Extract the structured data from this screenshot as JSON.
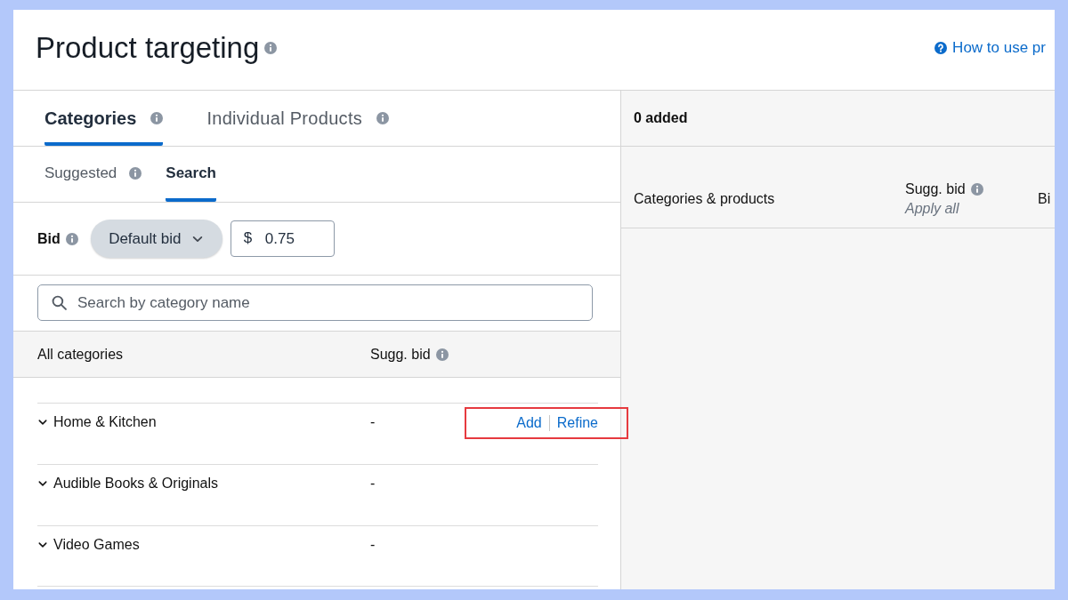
{
  "header": {
    "title": "Product targeting",
    "title_info": true,
    "help_link": "How to use pr"
  },
  "tabs": [
    {
      "label": "Categories",
      "info": true,
      "selected": true
    },
    {
      "label": "Individual Products",
      "info": true,
      "selected": false
    }
  ],
  "subtabs": [
    {
      "label": "Suggested",
      "info": true,
      "selected": false
    },
    {
      "label": "Search",
      "info": false,
      "selected": true
    }
  ],
  "bid": {
    "label": "Bid",
    "info": true,
    "mode": "Default bid",
    "currency": "$",
    "value": "0.75"
  },
  "search": {
    "placeholder": "Search by category name"
  },
  "categories_table": {
    "columns": [
      {
        "label": "All categories",
        "info": false
      },
      {
        "label": "Sugg. bid",
        "info": true
      }
    ],
    "rows": [
      {
        "name": "Home & Kitchen",
        "sugg_bid": "-",
        "actions": [
          "Add",
          "Refine"
        ],
        "highlighted": true
      },
      {
        "name": "Audible Books & Originals",
        "sugg_bid": "-",
        "highlighted": false
      },
      {
        "name": "Video Games",
        "sugg_bid": "-",
        "highlighted": false
      }
    ]
  },
  "added_panel": {
    "count_label": "0 added",
    "columns": [
      {
        "label": "Categories & products",
        "info": false
      },
      {
        "label": "Sugg. bid",
        "info": true,
        "sublabel": "Apply all"
      },
      {
        "label": "Bi",
        "info": false
      }
    ]
  }
}
